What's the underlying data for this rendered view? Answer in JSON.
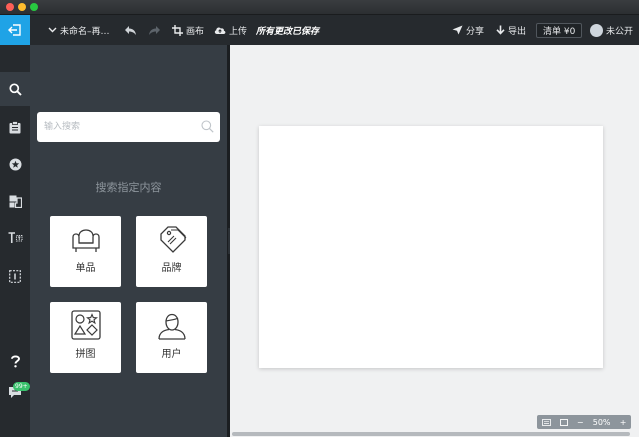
{
  "toolbar": {
    "title": "未命名–再…",
    "canvas_label": "画布",
    "upload_label": "上传",
    "save_status": "所有更改已保存",
    "share_label": "分享",
    "export_label": "导出",
    "price_label": "清单 ¥0",
    "visibility_label": "未公开"
  },
  "rail": {
    "items": [
      "search-icon",
      "template-icon",
      "star-icon",
      "material-icon",
      "text-icon",
      "frame-icon"
    ],
    "help_icon": "question-icon",
    "chat_badge": "99+"
  },
  "panel": {
    "search_placeholder": "输入搜索",
    "heading": "搜索指定内容",
    "cards": [
      {
        "label": "单品",
        "icon": "sofa-icon"
      },
      {
        "label": "品牌",
        "icon": "tags-icon"
      },
      {
        "label": "拼图",
        "icon": "shapes-icon"
      },
      {
        "label": "用户",
        "icon": "user-icon"
      }
    ]
  },
  "zoom": {
    "minus": "−",
    "value": "50%",
    "plus": "+"
  },
  "colors": {
    "accent": "#1fa3e6",
    "rail_bg": "#262a2e",
    "panel_bg": "#363d44",
    "workspace_bg": "#f0f1f2",
    "badge": "#39c16c"
  }
}
